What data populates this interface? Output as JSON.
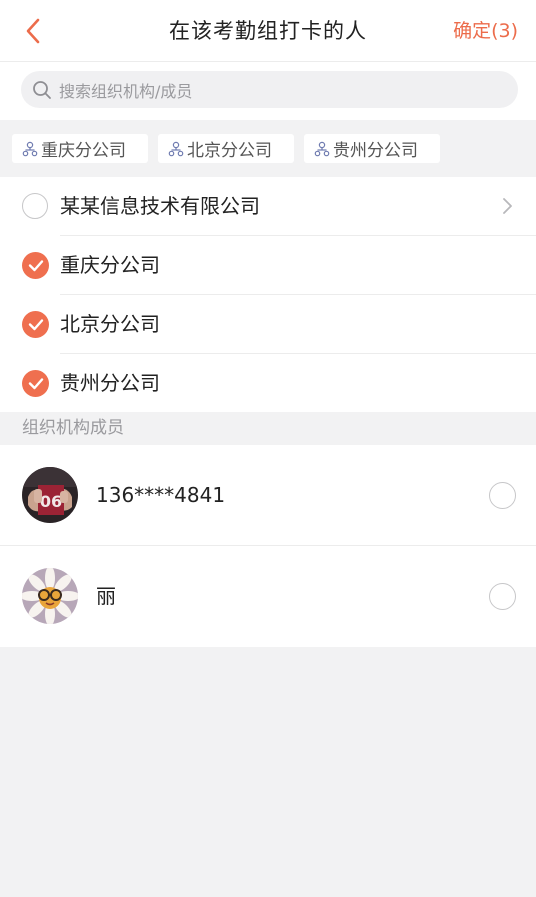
{
  "header": {
    "title": "在该考勤组打卡的人",
    "confirm_label": "确定(3)"
  },
  "search": {
    "placeholder": "搜索组织机构/成员"
  },
  "selected_chips": [
    {
      "label": "重庆分公司"
    },
    {
      "label": "北京分公司"
    },
    {
      "label": "贵州分公司"
    }
  ],
  "org_list": [
    {
      "label": "某某信息技术有限公司",
      "checked": false,
      "has_children": true
    },
    {
      "label": "重庆分公司",
      "checked": true,
      "has_children": false
    },
    {
      "label": "北京分公司",
      "checked": true,
      "has_children": false
    },
    {
      "label": "贵州分公司",
      "checked": true,
      "has_children": false
    }
  ],
  "members_section": {
    "title": "组织机构成员"
  },
  "members": [
    {
      "name": "136****4841",
      "checked": false
    },
    {
      "name": "丽",
      "checked": false
    }
  ],
  "colors": {
    "accent": "#ef6f4f",
    "confirm_text": "#ec6c4b"
  }
}
